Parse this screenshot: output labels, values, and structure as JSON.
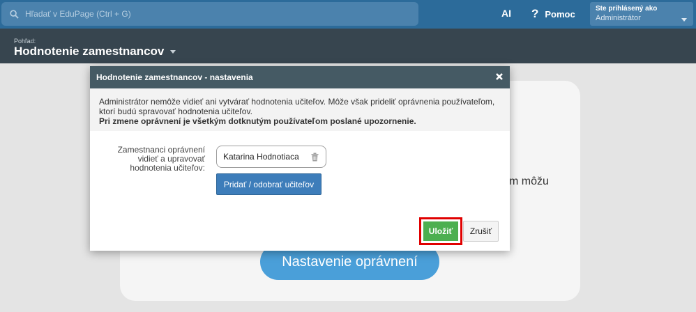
{
  "topbar": {
    "search_placeholder": "Hľadať v EduPage (Ctrl + G)",
    "ai_label": "AI",
    "help_label": "Pomoc",
    "user_line1": "Ste prihlásený ako",
    "user_line2": "Administrátor"
  },
  "view": {
    "label": "Pohľad:",
    "title": "Hodnotenie zamestnancov"
  },
  "background": {
    "partial_text": "m môžu",
    "settings_button": "Nastavenie oprávnení"
  },
  "modal": {
    "title": "Hodnotenie zamestnancov - nastavenia",
    "info_text": "Administrátor nemôže vidieť ani vytvárať hodnotenia učiteľov. Môže však prideliť oprávnenia používateľom, ktorí budú spravovať hodnotenia učiteľov.",
    "info_warning": "Pri zmene oprávnení je všetkým dotknutým používateľom poslané upozornenie.",
    "field_label": "Zamestnanci oprávnení vidieť a upravovať hodnotenia učiteľov:",
    "assigned_user": "Katarina Hodnotiaca",
    "assign_button": "Pridať / odobrať učiteľov",
    "save_button": "Uložiť",
    "cancel_button": "Zrušiť"
  },
  "icons": [
    "search-icon",
    "help-icon",
    "chevron-down-icon",
    "close-icon",
    "trash-icon"
  ],
  "colors": {
    "topbar": "#2c6b9a",
    "viewbar": "#37454f",
    "modal_header": "#455a64",
    "primary_button": "#3d7dba",
    "save_button": "#4caf50",
    "highlight": "#e00000"
  }
}
